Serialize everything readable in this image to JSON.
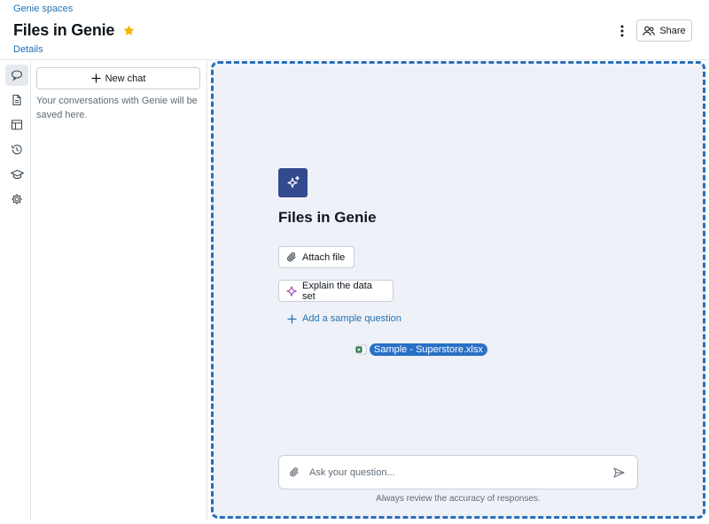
{
  "header": {
    "breadcrumb": "Genie spaces",
    "title": "Files in Genie",
    "details_link": "Details",
    "share_label": "Share"
  },
  "sidebar": {
    "items": [
      {
        "icon": "chat-icon",
        "active": true
      },
      {
        "icon": "document-icon",
        "active": false
      },
      {
        "icon": "table-icon",
        "active": false
      },
      {
        "icon": "history-icon",
        "active": false
      },
      {
        "icon": "graduation-cap-icon",
        "active": false
      },
      {
        "icon": "gear-icon",
        "active": false
      }
    ]
  },
  "chat_panel": {
    "new_chat_label": "New chat",
    "empty_text": "Your conversations with Genie will be saved here."
  },
  "main": {
    "title": "Files in Genie",
    "attach_label": "Attach file",
    "explain_label": "Explain the data set",
    "add_question_label": "Add a sample question",
    "dragged_file": "Sample - Superstore.xlsx",
    "ask_placeholder": "Ask your question...",
    "disclaimer": "Always review the accuracy of responses."
  },
  "colors": {
    "link": "#2272b4",
    "accent_tile": "#344a8e",
    "drop_border": "#2a6db5",
    "file_chip": "#2870c6",
    "star": "#f4b400"
  }
}
